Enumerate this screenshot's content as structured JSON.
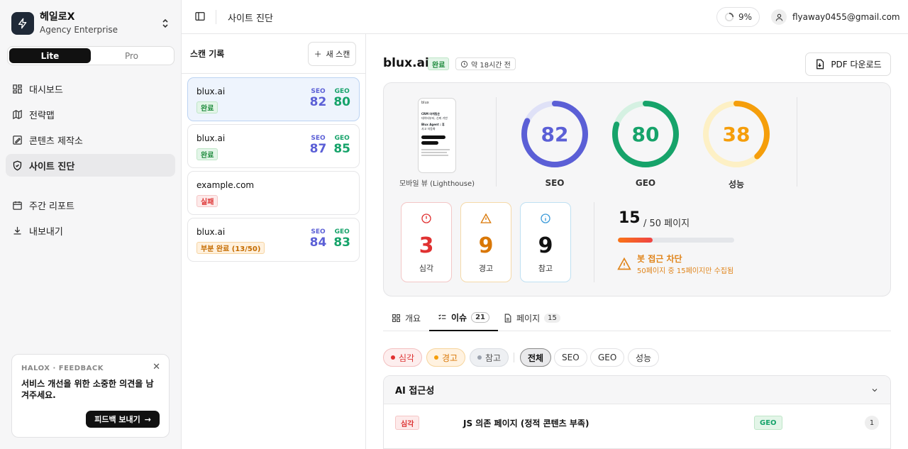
{
  "brand": {
    "name": "헤일로X",
    "plan": "Agency Enterprise"
  },
  "plan_toggle": {
    "lite": "Lite",
    "pro": "Pro"
  },
  "nav": [
    {
      "label": "대시보드",
      "icon": "dashboard-icon"
    },
    {
      "label": "전략맵",
      "icon": "map-icon"
    },
    {
      "label": "콘텐츠 제작소",
      "icon": "pencil-icon"
    },
    {
      "label": "사이트 진단",
      "icon": "shield-icon"
    },
    {
      "label": "주간 리포트",
      "icon": "calendar-icon"
    },
    {
      "label": "내보내기",
      "icon": "download-icon"
    }
  ],
  "feedback": {
    "label": "HALOX · FEEDBACK",
    "text": "서비스 개선을 위한 소중한 의견을 남겨주세요.",
    "button": "피드백 보내기"
  },
  "topbar": {
    "title": "사이트 진단",
    "progress": "9%",
    "email": "flyaway0455@gmail.com"
  },
  "scan_panel": {
    "title": "스캔 기록",
    "new_scan": "새 스캔",
    "seo_label": "SEO",
    "geo_label": "GEO",
    "items": [
      {
        "domain": "blux.ai",
        "status": "완료",
        "seo": "82",
        "geo": "80"
      },
      {
        "domain": "blux.ai",
        "status": "완료",
        "seo": "87",
        "geo": "85"
      },
      {
        "domain": "example.com",
        "status": "실패"
      },
      {
        "domain": "blux.ai",
        "status": "부분 완료 (13/50)",
        "seo": "84",
        "geo": "83"
      }
    ]
  },
  "main": {
    "domain": "blux.ai",
    "status": "완료",
    "time": "약 18시간 전",
    "pdf": "PDF 다운로드",
    "preview_caption": "모바일 뷰 (Lighthouse)",
    "preview_lines": [
      "blux",
      "CRM 마케팅은",
      "데이터부터, 신뢰 기반",
      "Blux Agent : 휴",
      "사고 자동화"
    ],
    "gauges": [
      {
        "label": "SEO",
        "value": "82",
        "pct": 82,
        "color": "#5b5fd6",
        "track": "#dfe1f7"
      },
      {
        "label": "GEO",
        "value": "80",
        "pct": 80,
        "color": "#16a36a",
        "track": "#d5f1e2"
      },
      {
        "label": "성능",
        "value": "38",
        "pct": 38,
        "color": "#f59e0b",
        "track": "#fdf0c5"
      }
    ],
    "stats": [
      {
        "num": "3",
        "label": "심각",
        "color": "#e03131",
        "border": "#f3c6c6"
      },
      {
        "num": "9",
        "label": "경고",
        "color": "#d97706",
        "border": "#f5d9a8"
      },
      {
        "num": "9",
        "label": "참고",
        "color": "#111111",
        "border": "#bfe0f2"
      }
    ],
    "pages": {
      "crawled": "15",
      "total": "/ 50 페이지",
      "progress": 0.3
    },
    "bot_block": {
      "title": "봇 접근 차단",
      "sub": "50페이지 중 15페이지만 수집됨"
    },
    "tabs": [
      {
        "label": "개요",
        "count": ""
      },
      {
        "label": "이슈",
        "count": "21"
      },
      {
        "label": "페이지",
        "count": "15"
      }
    ],
    "chips": [
      "심각",
      "경고",
      "참고",
      "전체",
      "SEO",
      "GEO",
      "성능"
    ],
    "section": {
      "title": "AI 접근성",
      "row": {
        "severity": "심각",
        "title": "JS 의존 페이지 (정적 콘텐츠 부족)",
        "tag": "GEO",
        "count": "1"
      }
    }
  }
}
